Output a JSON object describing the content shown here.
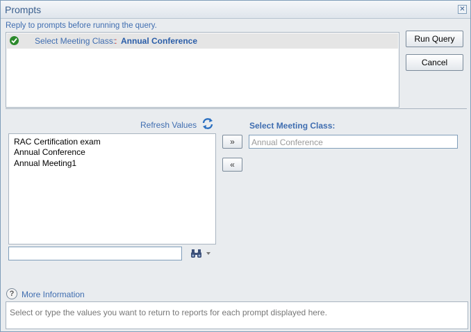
{
  "window": {
    "title": "Prompts"
  },
  "instruction": "Reply to prompts before running the query.",
  "prompts": [
    {
      "label": "Select Meeting Class:",
      "separator": ":",
      "value": "Annual Conference",
      "status_icon": "check-icon"
    }
  ],
  "buttons": {
    "run_query": "Run Query",
    "cancel": "Cancel",
    "add": "»",
    "remove": "«"
  },
  "refresh": {
    "label": "Refresh Values",
    "icon": "refresh-icon"
  },
  "values": [
    "RAC Certification exam",
    "Annual Conference",
    "Annual Meeting1"
  ],
  "search": {
    "value": "",
    "icon": "binoculars-icon"
  },
  "selected": {
    "heading": "Select Meeting Class:",
    "value": "Annual Conference"
  },
  "more_info": {
    "label": "More Information",
    "icon": "question-icon"
  },
  "help_text": "Select or type the values you want to return to reports for each prompt displayed here.",
  "colors": {
    "link": "#3f6db0",
    "value": "#2a5da8",
    "separator": "#c00000",
    "check": "#2c8a2c"
  }
}
